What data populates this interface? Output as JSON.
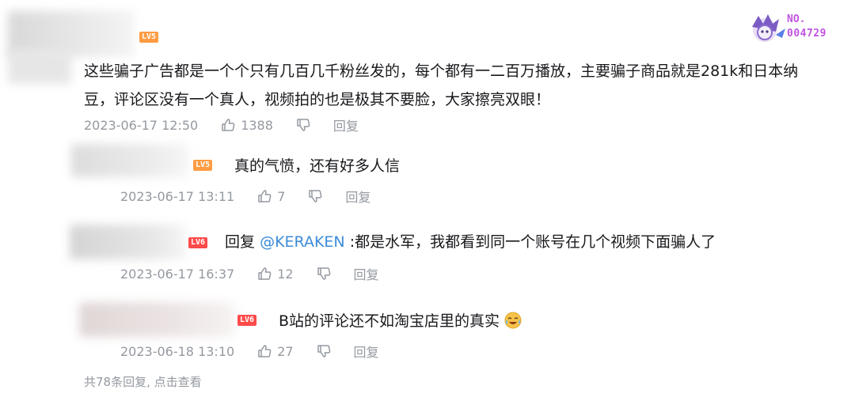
{
  "main_comment": {
    "level": "LV5",
    "badge": {
      "line1": "NO.",
      "line2": "004729"
    },
    "text_line1": "这些骗子广告都是一个个只有几百几千粉丝发的，每个都有一二百万播放，主要骗子商品就是281k和日本纳",
    "text_line2": "豆，评论区没有一个真人，视频拍的也是极其不要脸，大家擦亮双眼！",
    "time": "2023-06-17 12:50",
    "likes": "1388",
    "reply_label": "回复"
  },
  "replies": [
    {
      "level": "LV5",
      "text": "真的气愤，还有好多人信",
      "time": "2023-06-17 13:11",
      "likes": "7",
      "reply_label": "回复"
    },
    {
      "level": "LV6",
      "reply_prefix": "回复",
      "mention": "@KERAKEN",
      "text": ":都是水军，我都看到同一个账号在几个视频下面骗人了",
      "time": "2023-06-17 16:37",
      "likes": "12",
      "reply_label": "回复"
    },
    {
      "level": "LV6",
      "text": "B站的评论还不如淘宝店里的真实",
      "emoji": "laugh-cry-emoji",
      "time": "2023-06-18 13:10",
      "likes": "27",
      "reply_label": "回复"
    }
  ],
  "more_replies": "共78条回复, 点击查看",
  "colors": {
    "text": "#18191c",
    "meta": "#9499a0",
    "mention": "#3b8bd9",
    "lv5": "#ff9c43",
    "lv6": "#ff4a4a",
    "badge": "#c153e0"
  }
}
